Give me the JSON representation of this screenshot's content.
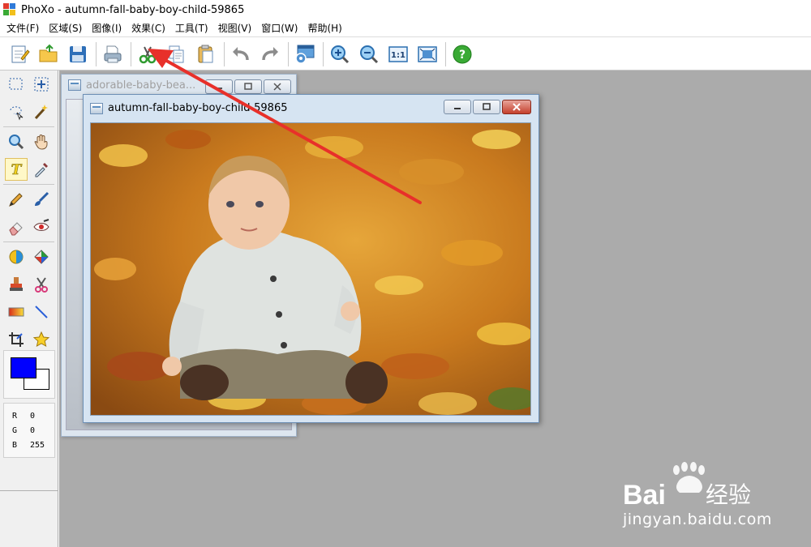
{
  "app": {
    "title": "PhoXo - autumn-fall-baby-boy-child-59865",
    "icon": "phoxo-logo-icon"
  },
  "menu": [
    "文件(F)",
    "区域(S)",
    "图像(I)",
    "效果(C)",
    "工具(T)",
    "视图(V)",
    "窗口(W)",
    "帮助(H)"
  ],
  "toolbar": {
    "buttons": [
      "new-document-icon",
      "open-folder-icon",
      "save-icon",
      "print-icon",
      "cut-icon",
      "copy-icon",
      "paste-icon",
      "undo-icon",
      "redo-icon",
      "screen-capture-icon",
      "zoom-in-icon",
      "zoom-out-icon",
      "actual-size-icon",
      "fit-window-icon",
      "help-icon"
    ],
    "actual_size_label": "1:1",
    "help_label": "?"
  },
  "toolbox": {
    "tools": [
      [
        "rect-select-icon",
        "move-icon"
      ],
      [
        "lasso-select-icon",
        "magic-wand-icon"
      ],
      [
        "zoom-icon",
        "hand-pan-icon"
      ],
      [
        "text-tool-icon",
        "eyedropper-icon"
      ],
      [
        "pencil-icon",
        "brush-icon"
      ],
      [
        "eraser-icon",
        "red-eye-icon"
      ],
      [
        "fill-bucket-icon",
        "color-fill-icon"
      ],
      [
        "clone-stamp-icon",
        "scissors-icon"
      ],
      [
        "gradient-icon",
        "line-icon"
      ],
      [
        "crop-icon",
        "star-shape-icon"
      ]
    ],
    "active_tool": "text-tool-icon",
    "text_tool_label": "T",
    "foreground_color": "#0000ff",
    "background_color": "#ffffff",
    "rgb": [
      {
        "key": "R",
        "value": "0"
      },
      {
        "key": "G",
        "value": "0"
      },
      {
        "key": "B",
        "value": "255"
      }
    ]
  },
  "windows": {
    "back": {
      "title": "adorable-baby-bea..."
    },
    "front": {
      "title": "autumn-fall-baby-boy-child-59865"
    }
  },
  "watermark": {
    "brand_prefix": "Bai",
    "brand_suffix": "经验",
    "url": "jingyan.baidu.com"
  },
  "colors": {
    "annotation_arrow": "#e8302a",
    "workspace_bg": "#ababab",
    "foreground": "#0000ff"
  }
}
